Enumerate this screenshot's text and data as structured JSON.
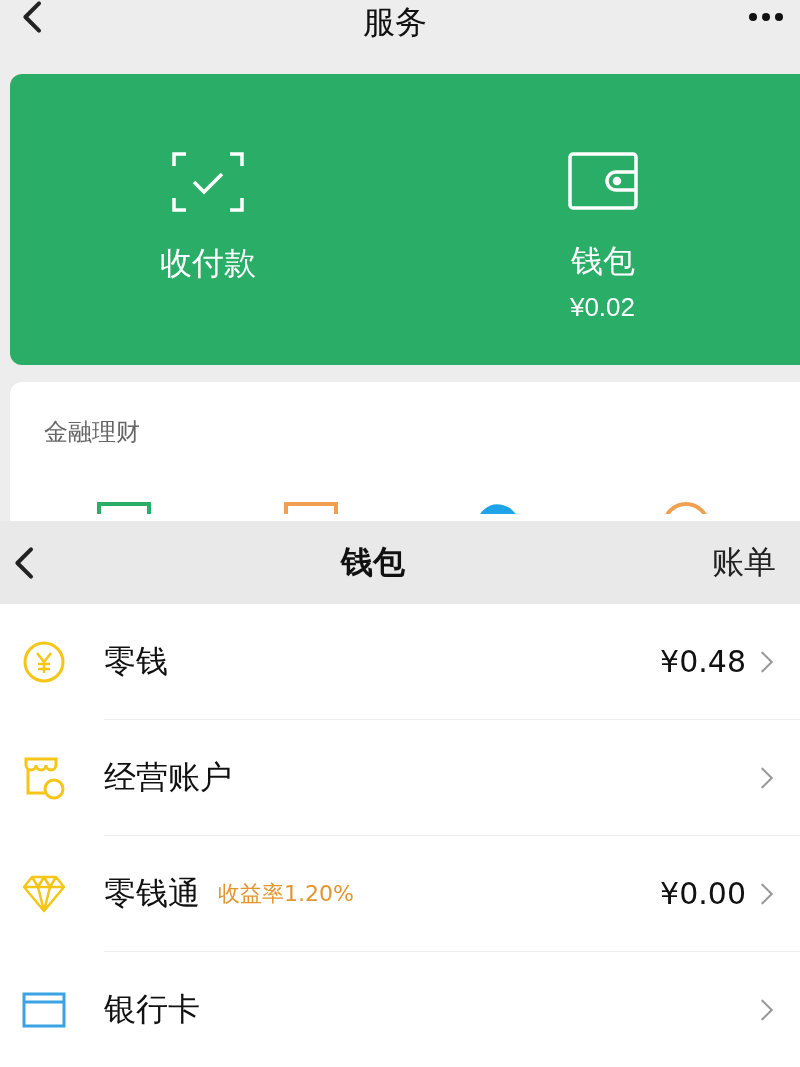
{
  "top_bar": {
    "title": "服务"
  },
  "pay_card": {
    "items": [
      {
        "label": "收付款"
      },
      {
        "label": "钱包",
        "amount": "¥0.02"
      }
    ]
  },
  "finance": {
    "title": "金融理财"
  },
  "wallet_bar": {
    "title": "钱包",
    "action": "账单"
  },
  "wallet_rows": [
    {
      "label": "零钱",
      "amount": "¥0.48"
    },
    {
      "label": "经营账户"
    },
    {
      "label": "零钱通",
      "badge": "收益率1.20%",
      "amount": "¥0.00"
    },
    {
      "label": "银行卡"
    }
  ]
}
